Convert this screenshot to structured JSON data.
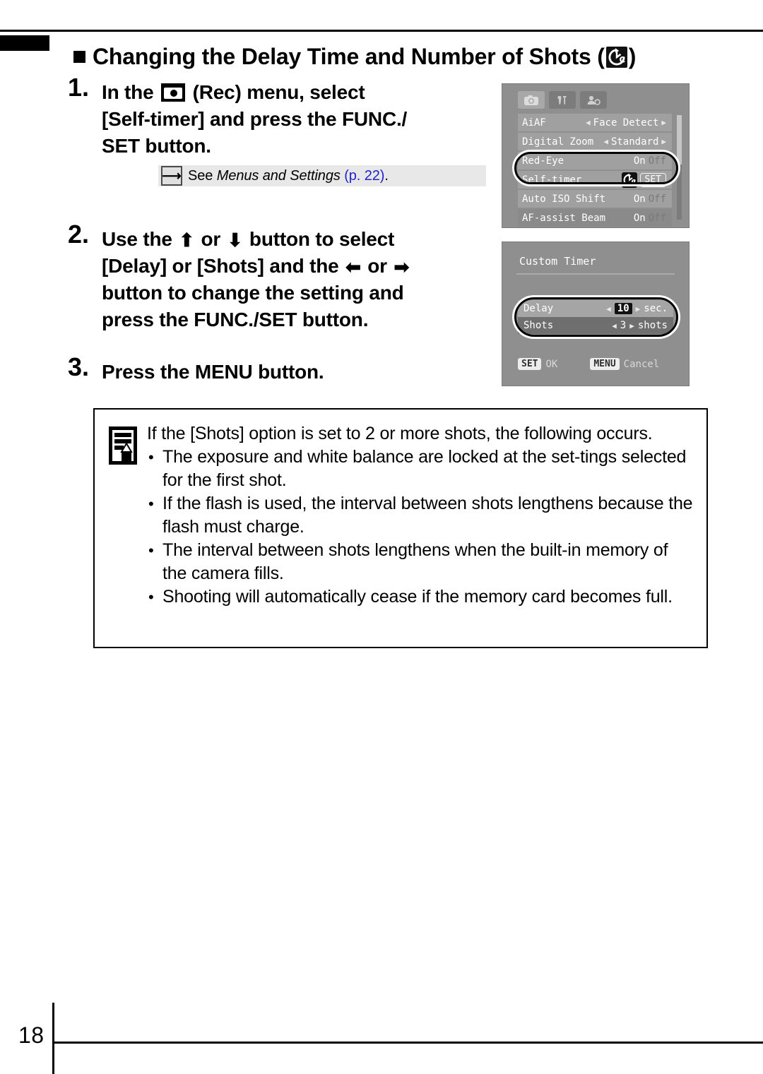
{
  "page": {
    "number": "18"
  },
  "heading": {
    "text": "Changing the Delay Time and Number of Shots (",
    "text_tail": ")",
    "icon": "self-timer-icon"
  },
  "steps": [
    {
      "number": "1.",
      "line1_pre": "In the",
      "line1_icon": "rec-camera-icon",
      "line1_post": "(Rec) menu, select",
      "line2": "[Self-timer] and press the FUNC./",
      "line3": "SET button.",
      "xref": {
        "arrow_icon": "arrow-right-icon",
        "see": "See",
        "title": "Menus and Settings",
        "page_ref": "(p. 22)",
        "period": "."
      }
    },
    {
      "number": "2.",
      "line1_pre": "Use the",
      "up_icon": "⬆",
      "line1_mid": "or",
      "down_icon": "⬇",
      "line1_post": "button to select",
      "line2_pre": "[Delay] or [Shots] and the",
      "left_icon": "⬅",
      "line2_mid": "or",
      "right_icon": "➡",
      "line3": "button to change the setting and",
      "line4": "press the FUNC./SET button."
    },
    {
      "number": "3.",
      "line1": "Press the MENU button."
    }
  ],
  "lcd_rec_menu": {
    "tabs": [
      {
        "name": "camera-tab",
        "icon": "camera-icon",
        "active": true
      },
      {
        "name": "settings-tab",
        "icon": "wrench-icon",
        "active": false
      },
      {
        "name": "my-camera-tab",
        "icon": "person-icon",
        "active": false
      }
    ],
    "rows": [
      {
        "label": "AiAF",
        "value": "Face Detect",
        "type": "arrows"
      },
      {
        "label": "Digital Zoom",
        "value": "Standard",
        "type": "arrows"
      },
      {
        "label": "Red-Eye",
        "value_on": "On",
        "value_off": "Off",
        "type": "onoff",
        "obscured": true
      },
      {
        "label": "Self-timer",
        "value": "SET",
        "type": "set-button"
      },
      {
        "label": "Auto ISO Shift",
        "value_on": "On",
        "value_off": "Off",
        "type": "onoff",
        "obscured": true
      },
      {
        "label": "AF-assist Beam",
        "value_on": "On",
        "value_off": "Off",
        "type": "onoff"
      }
    ],
    "highlight_target": "Self-timer"
  },
  "lcd_custom_timer": {
    "title": "Custom Timer",
    "rows": [
      {
        "label": "Delay",
        "value": "10",
        "unit": "sec.",
        "highlighted": true
      },
      {
        "label": "Shots",
        "value": "3",
        "unit": "shots",
        "highlighted": false
      }
    ],
    "footer": {
      "set_key": "SET",
      "set_action": "OK",
      "menu_key": "MENU",
      "menu_action": "Cancel"
    }
  },
  "note": {
    "icon": "notepad-pencil-icon",
    "lead": "If the [Shots] option is set to 2 or more shots, the following occurs.",
    "bullets": [
      "The exposure and white balance are locked at the set-tings selected for the first shot.",
      "If the flash is used, the interval between shots lengthens because the flash must charge.",
      "The interval between shots lengthens when the built-in memory of the camera fills.",
      "Shooting will automatically cease if the memory card becomes full."
    ]
  },
  "colors": {
    "page_ref_blue": "#2222cc",
    "lcd_background": "#8f8f8f",
    "xref_band": "#e8e8e8"
  }
}
